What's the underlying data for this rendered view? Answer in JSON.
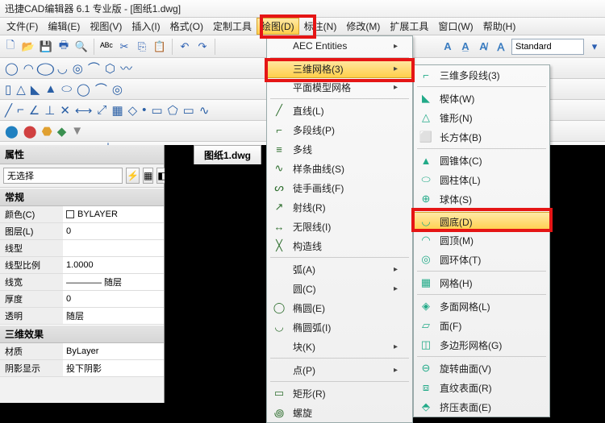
{
  "title": "迅捷CAD编辑器 6.1 专业版 - [图纸1.dwg]",
  "menubar": {
    "file": "文件(F)",
    "edit": "编辑(E)",
    "view": "视图(V)",
    "insert": "插入(I)",
    "format": "格式(O)",
    "custom": "定制工具",
    "draw": "绘图(D)",
    "annot": "标注(N)",
    "modify": "修改(M)",
    "ext": "扩展工具",
    "window": "窗口(W)",
    "help": "帮助(H)"
  },
  "style_combo": "Standard",
  "tab_name": "图纸1.dwg",
  "props": {
    "panel_title": "属性",
    "noselect": "无选择",
    "group1": "常规",
    "rows1": [
      {
        "k": "颜色(C)",
        "v": "BYLAYER",
        "sw": true
      },
      {
        "k": "图层(L)",
        "v": "0"
      },
      {
        "k": "线型",
        "v": ""
      },
      {
        "k": "线型比例",
        "v": "1.0000"
      },
      {
        "k": "线宽",
        "v": "———— 随层"
      },
      {
        "k": "厚度",
        "v": "0"
      },
      {
        "k": "透明",
        "v": "随层"
      }
    ],
    "group2": "三维效果",
    "rows2": [
      {
        "k": "材质",
        "v": "ByLayer"
      },
      {
        "k": "阴影显示",
        "v": "投下阴影"
      }
    ]
  },
  "menu1": {
    "aec": "AEC Entities",
    "mesh3d": "三维网格(3)",
    "planar": "平面模型网格",
    "line": "直线(L)",
    "pline": "多段线(P)",
    "mline": "多线",
    "spline": "样条曲线(S)",
    "freehand": "徒手画线(F)",
    "ray": "射线(R)",
    "xline": "无限线(I)",
    "constr": "构造线",
    "arc": "弧(A)",
    "circle": "圆(C)",
    "ellipse": "椭圆(E)",
    "earc": "椭圆弧(I)",
    "block": "块(K)",
    "point": "点(P)",
    "rect": "矩形(R)",
    "spiral": "螺旋"
  },
  "menu2": {
    "pline3d": "三维多段线(3)",
    "wedge": "楔体(W)",
    "cone": "锥形(N)",
    "box": "长方体(B)",
    "conebody": "圆锥体(C)",
    "cyl": "圆柱体(L)",
    "sphere": "球体(S)",
    "dome": "圆底(D)",
    "dometop": "圆顶(M)",
    "torus": "圆环体(T)",
    "mesh": "网格(H)",
    "polyface": "多面网格(L)",
    "face": "面(F)",
    "polymesh": "多边形网格(G)",
    "revsurf": "旋转曲面(V)",
    "rulesurf": "直纹表面(R)",
    "extsurf": "挤压表面(E)"
  }
}
